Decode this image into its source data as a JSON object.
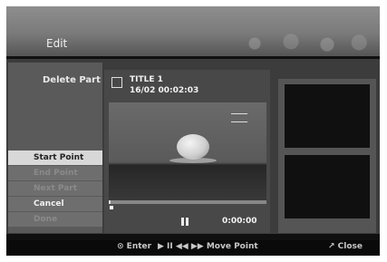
{
  "header": {
    "title": "Edit"
  },
  "left_panel": {
    "label": "Delete Part"
  },
  "menu": {
    "items": [
      {
        "label": "Start Point",
        "state": "selected"
      },
      {
        "label": "End Point",
        "state": "disabled"
      },
      {
        "label": "Next Part",
        "state": "disabled"
      },
      {
        "label": "Cancel",
        "state": "enabled"
      },
      {
        "label": "Done",
        "state": "disabled"
      }
    ]
  },
  "title_info": {
    "title": "TITLE 1",
    "date_time": "16/02   00:02:03"
  },
  "player": {
    "counter": "0:00:00",
    "progress_fraction": 0.01
  },
  "footer": {
    "enter": "⊙ Enter",
    "move_point": "▶ II ◀◀ ▶▶ Move Point",
    "close": "↗ Close"
  },
  "colors": {
    "selected_bg": "#d8d8d8",
    "panel_bg": "#3c3c3c",
    "header_bg": "#7a7a7a"
  }
}
